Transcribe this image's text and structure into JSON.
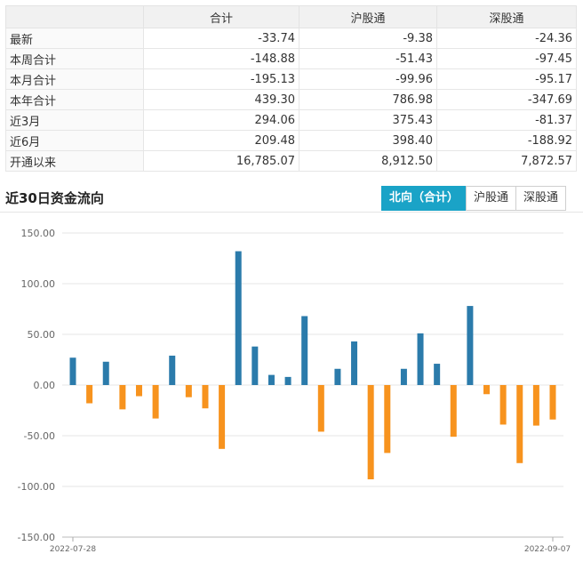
{
  "table": {
    "headers": [
      "",
      "合计",
      "沪股通",
      "深股通"
    ],
    "rows": [
      {
        "label": "最新",
        "total": "-33.74",
        "sh": "-9.38",
        "sz": "-24.36"
      },
      {
        "label": "本周合计",
        "total": "-148.88",
        "sh": "-51.43",
        "sz": "-97.45"
      },
      {
        "label": "本月合计",
        "total": "-195.13",
        "sh": "-99.96",
        "sz": "-95.17"
      },
      {
        "label": "本年合计",
        "total": "439.30",
        "sh": "786.98",
        "sz": "-347.69"
      },
      {
        "label": "近3月",
        "total": "294.06",
        "sh": "375.43",
        "sz": "-81.37"
      },
      {
        "label": "近6月",
        "total": "209.48",
        "sh": "398.40",
        "sz": "-188.92"
      },
      {
        "label": "开通以来",
        "total": "16,785.07",
        "sh": "8,912.50",
        "sz": "7,872.57"
      }
    ]
  },
  "section_title": "近30日资金流向",
  "tabs": [
    {
      "label": "北向（合计）",
      "active": true
    },
    {
      "label": "沪股通",
      "active": false
    },
    {
      "label": "深股通",
      "active": false
    }
  ],
  "colors": {
    "positive": "#2b7bab",
    "negative": "#f7931e",
    "tab_active": "#1aa3c7"
  },
  "chart_data": {
    "type": "bar",
    "title": "",
    "xlabel": "",
    "ylabel": "",
    "ylim": [
      -150,
      150
    ],
    "yticks": [
      150,
      100,
      50,
      0,
      -50,
      -100,
      -150
    ],
    "ytick_labels": [
      "150.00",
      "100.00",
      "50.00",
      "0.00",
      "-50.00",
      "-100.00",
      "-150.00"
    ],
    "x_start_label": "2022-07-28",
    "x_end_label": "2022-09-07",
    "values": [
      27,
      -18,
      23,
      -24,
      -11,
      -33,
      29,
      -12,
      -23,
      -63,
      132,
      38,
      10,
      8,
      68,
      -46,
      16,
      43,
      -93,
      -67,
      16,
      51,
      21,
      -51,
      78,
      -9,
      -39,
      -77,
      -40,
      -34
    ]
  }
}
